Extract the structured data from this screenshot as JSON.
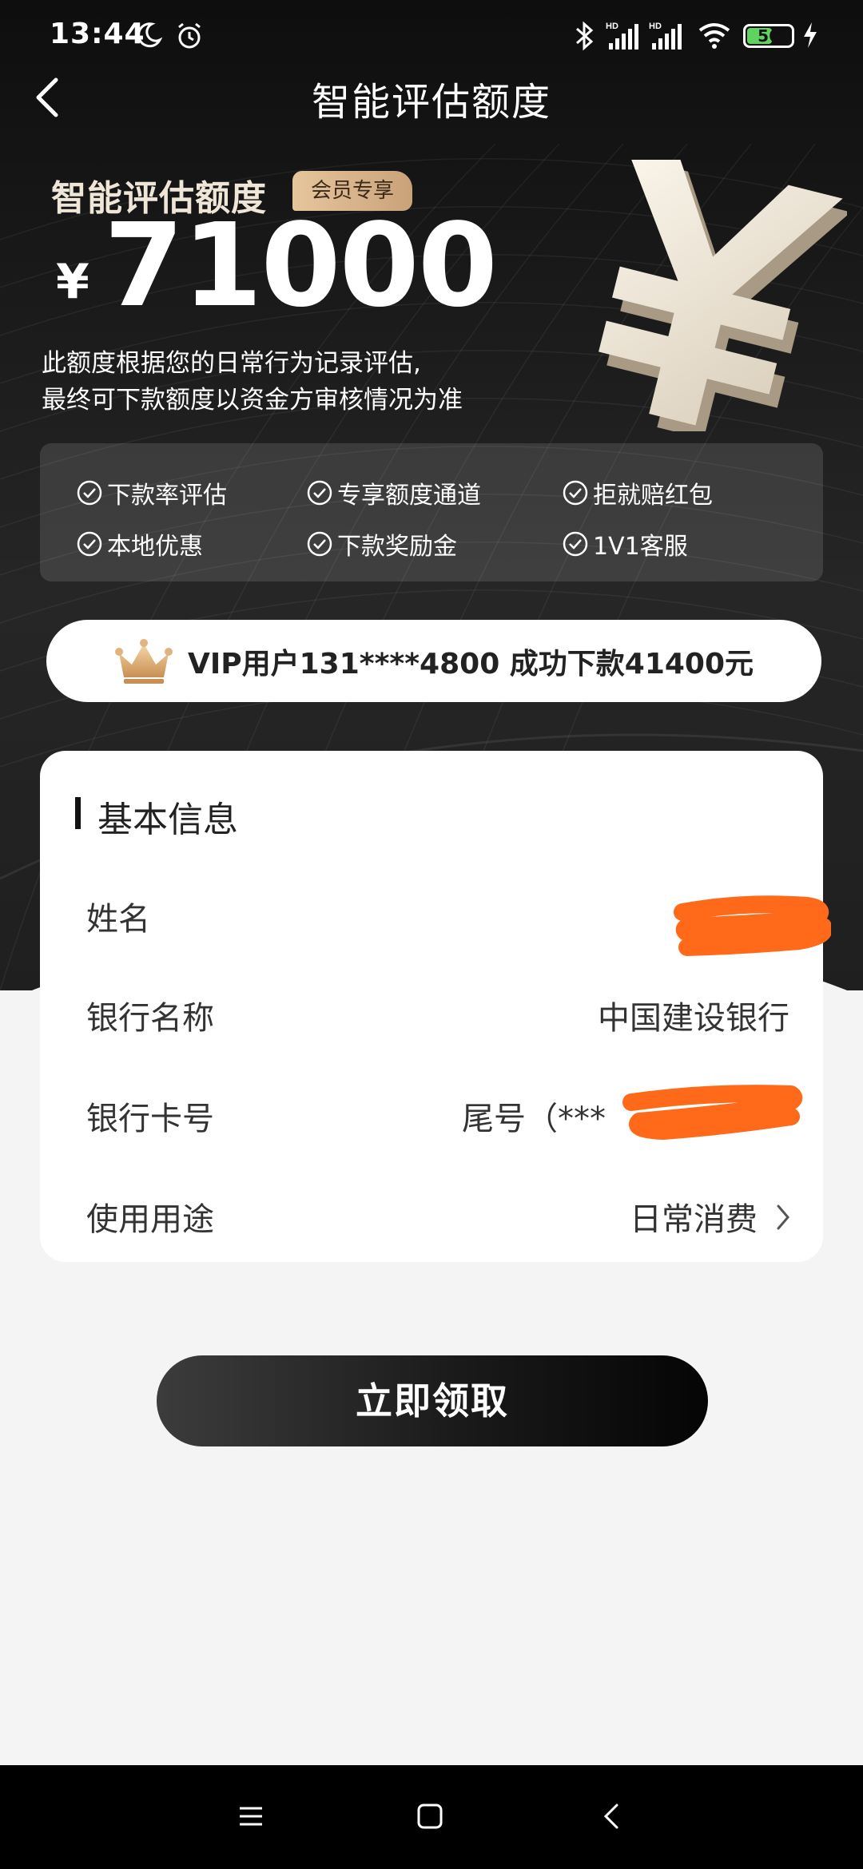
{
  "status_bar": {
    "time": "13:44",
    "battery": "56",
    "icons": [
      "moon-icon",
      "alarm-icon",
      "bluetooth-icon",
      "signal-hd-icon",
      "signal-hd-icon",
      "wifi-icon",
      "battery-icon",
      "charging-icon"
    ]
  },
  "nav": {
    "title": "智能评估额度",
    "back_icon": "chevron-left-icon"
  },
  "hero": {
    "quota_label": "智能评估额度",
    "member_badge": "会员专享",
    "currency": "¥",
    "amount": "71000",
    "desc_line1": "此额度根据您的日常行为记录评估,",
    "desc_line2": "最终可下款额度以资金方审核情况为准"
  },
  "benefits": [
    {
      "label": "下款率评估"
    },
    {
      "label": "专享额度通道"
    },
    {
      "label": "拒就赔红包"
    },
    {
      "label": "本地优惠"
    },
    {
      "label": "下款奖励金"
    },
    {
      "label": "1V1客服"
    }
  ],
  "vip_ticker": {
    "text": "VIP用户131****4800 成功下款41400元"
  },
  "info_card": {
    "title": "基本信息",
    "rows": [
      {
        "label": "姓名",
        "value": ""
      },
      {
        "label": "银行名称",
        "value": "中国建设银行"
      },
      {
        "label": "银行卡号",
        "value": "尾号（***"
      },
      {
        "label": "使用用途",
        "value": "日常消费"
      }
    ]
  },
  "cta": {
    "label": "立即领取"
  },
  "colors": {
    "accent_gold": "#e6c59d",
    "redaction": "#ff6a1a",
    "dark": "#111111"
  }
}
